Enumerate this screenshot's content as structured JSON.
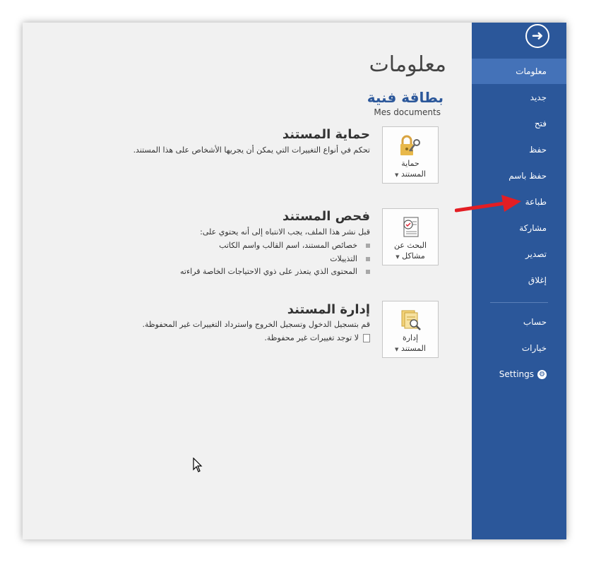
{
  "sidebar": {
    "back_icon": "back-arrow-icon",
    "items": [
      {
        "label": "معلومات",
        "active": true
      },
      {
        "label": "جديد"
      },
      {
        "label": "فتح"
      },
      {
        "label": "حفظ"
      },
      {
        "label": "حفظ باسم"
      },
      {
        "label": "طباعة"
      },
      {
        "label": "مشاركة"
      },
      {
        "label": "تصدير"
      },
      {
        "label": "إغلاق"
      }
    ],
    "lower_items": [
      {
        "label": "حساب"
      },
      {
        "label": "خيارات"
      }
    ],
    "settings_label": "Settings",
    "accent_color": "#2b579a"
  },
  "main": {
    "page_title": "معلومات",
    "doc_title": "بطاقة فنية",
    "doc_path": "Mes documents",
    "protect": {
      "button_line1": "حماية",
      "button_line2": "المستند",
      "title": "حماية المستند",
      "desc": "تحكم في أنواع التغييرات التي يمكن أن يجريها الأشخاص على هذا المستند."
    },
    "inspect": {
      "button_line1": "البحث عن",
      "button_line2": "مشاكل",
      "title": "فحص المستند",
      "desc": "قبل نشر هذا الملف، يجب الانتباه إلى أنه يحتوي على:",
      "bullets": [
        "خصائص المستند، اسم القالب واسم الكاتب",
        "التذييلات",
        "المحتوى الذي يتعذر على ذوي الاحتياجات الخاصة قراءته"
      ]
    },
    "manage": {
      "button_line1": "إدارة",
      "button_line2": "المستند",
      "title": "إدارة المستند",
      "desc": "قم بتسجيل الدخول وتسجيل الخروج واسترداد التغييرات غير المحفوظة.",
      "note": "لا توجد تغييرات غير محفوظة."
    }
  },
  "annotation": {
    "arrow_color": "#e31e24"
  }
}
